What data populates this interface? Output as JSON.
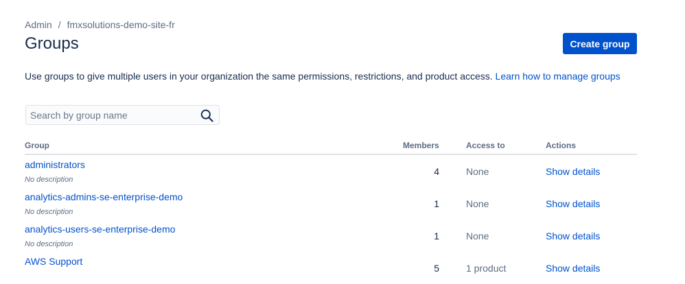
{
  "breadcrumb": {
    "items": [
      "Admin",
      "fmxsolutions-demo-site-fr"
    ],
    "separator": "/"
  },
  "page": {
    "title": "Groups",
    "create_button_label": "Create group",
    "intro_text": "Use groups to give multiple users in your organization the same permissions, restrictions, and product access.",
    "intro_link_text": "Learn how to manage groups"
  },
  "search": {
    "placeholder": "Search by group name",
    "value": "",
    "icon": "search-icon"
  },
  "table": {
    "headers": {
      "group": "Group",
      "members": "Members",
      "access": "Access to",
      "actions": "Actions"
    },
    "rows": [
      {
        "name": "administrators",
        "description": "No description",
        "members": "4",
        "access": "None",
        "action": "Show details"
      },
      {
        "name": "analytics-admins-se-enterprise-demo",
        "description": "No description",
        "members": "1",
        "access": "None",
        "action": "Show details"
      },
      {
        "name": "analytics-users-se-enterprise-demo",
        "description": "No description",
        "members": "1",
        "access": "None",
        "action": "Show details"
      },
      {
        "name": "AWS Support",
        "description": "",
        "members": "5",
        "access": "1 product",
        "action": "Show details"
      }
    ]
  },
  "colors": {
    "primary": "#0052cc",
    "text": "#172b4d",
    "subtle_text": "#5e6c84",
    "border": "#dfe1e6"
  }
}
